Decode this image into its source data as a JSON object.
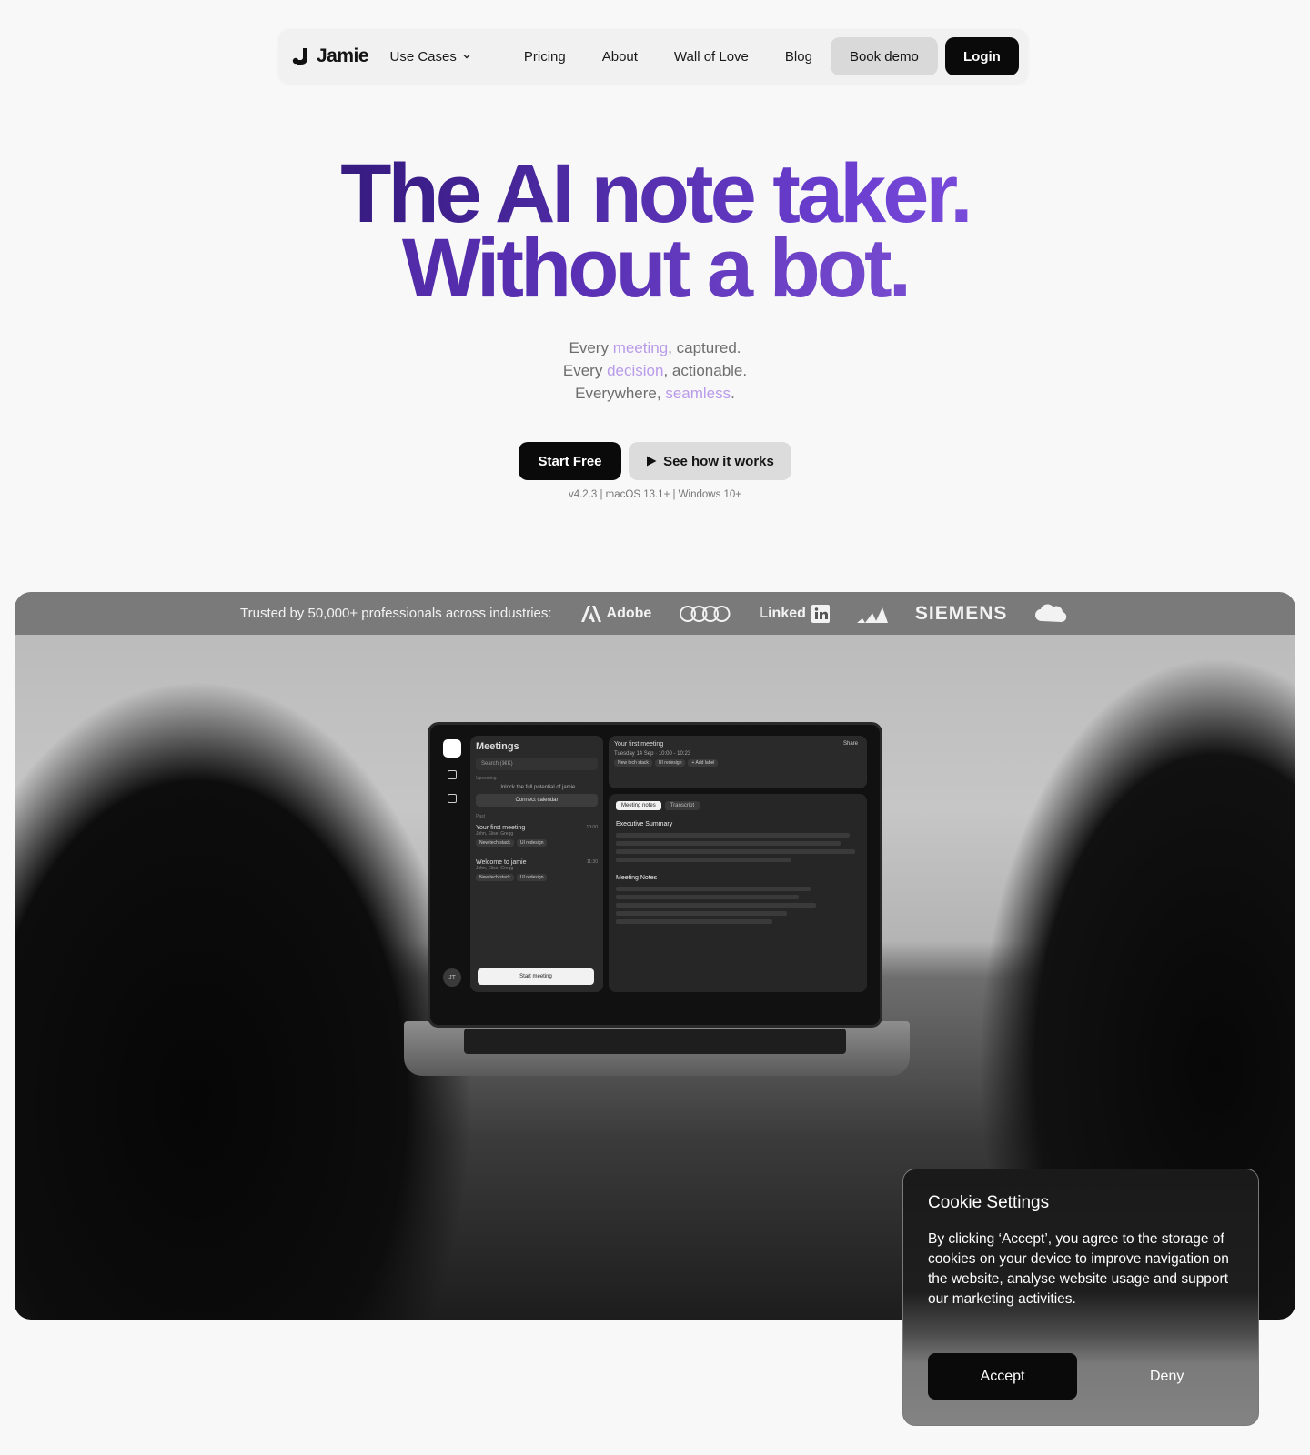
{
  "nav": {
    "brand": "Jamie",
    "links": [
      "Use Cases",
      "Pricing",
      "About",
      "Wall of Love",
      "Blog"
    ],
    "book_demo": "Book demo",
    "login": "Login"
  },
  "hero": {
    "title_line1": "The AI note taker.",
    "title_line2": "Without a bot.",
    "sub1": {
      "pre": "Every ",
      "hl": "meeting",
      "post": ", captured."
    },
    "sub2": {
      "pre": "Every ",
      "hl": "decision",
      "post": ", actionable."
    },
    "sub3": {
      "pre": "Everywhere, ",
      "hl": "seamless",
      "post": "."
    },
    "start_free": "Start Free",
    "see_how": "See how it works",
    "version": "v4.2.3 | macOS 13.1+ | Windows 10+"
  },
  "trust": {
    "text": "Trusted by 50,000+ professionals across industries:",
    "brands": [
      "Adobe",
      "Linked",
      "SIEMENS"
    ]
  },
  "app_screen": {
    "meetings_title": "Meetings",
    "search": "Search (⌘K)",
    "upcoming": "Upcoming",
    "unlock": "Unlock the full potential of jamie",
    "connect": "Connect calendar",
    "past": "Past",
    "meeting1": {
      "title": "Your first meeting",
      "people": "John, Elise, Gregg",
      "time": "10:00"
    },
    "meeting2": {
      "title": "Welcome to jamie",
      "people": "John, Elise, Gregg",
      "time": "11:30"
    },
    "tags": [
      "New tech stack",
      "UI redesign"
    ],
    "start_meeting": "Start meeting",
    "avatar": "JT",
    "detail_title": "Your first meeting",
    "detail_date": "Tuesday 14 Sep",
    "detail_time": "10:00 - 10:23",
    "add_label": "+ Add label",
    "share": "Share",
    "tab_notes": "Meeting notes",
    "tab_transcript": "Transcript",
    "exec_summary": "Executive Summary",
    "meeting_notes": "Meeting Notes"
  },
  "cookie": {
    "title": "Cookie Settings",
    "body": "By clicking ‘Accept’, you agree to the storage of cookies on your device to improve navigation on the website, analyse website usage and support our marketing activities.",
    "accept": "Accept",
    "deny": "Deny"
  }
}
